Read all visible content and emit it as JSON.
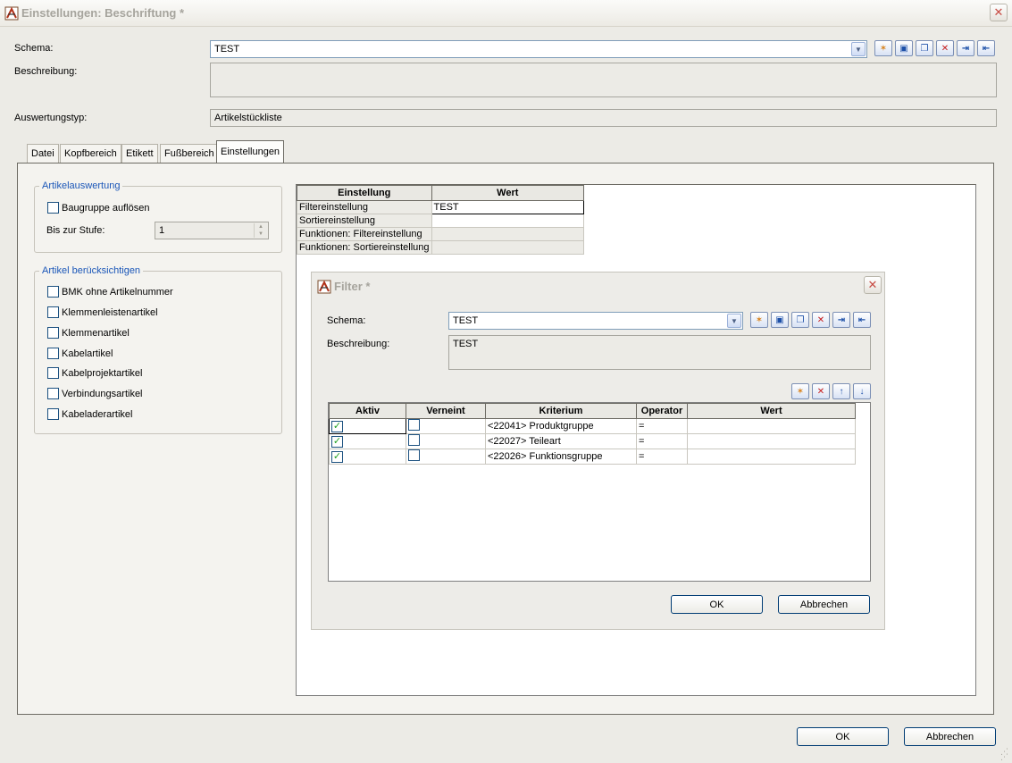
{
  "window": {
    "title": "Einstellungen: Beschriftung *",
    "close_glyph": "✕"
  },
  "schema": {
    "label": "Schema:",
    "value": "TEST",
    "description_label": "Beschreibung:",
    "description_value": "",
    "evaluation_label": "Auswertungstyp:",
    "evaluation_value": "Artikelstückliste",
    "toolbar_icons": [
      "new-icon",
      "save-icon",
      "copy-icon",
      "delete-icon",
      "import-icon",
      "export-icon"
    ]
  },
  "tabs": [
    {
      "label": "Datei",
      "active": false
    },
    {
      "label": "Kopfbereich",
      "active": false
    },
    {
      "label": "Etikett",
      "active": false
    },
    {
      "label": "Fußbereich",
      "active": false
    },
    {
      "label": "Einstellungen",
      "active": true
    }
  ],
  "article_eval": {
    "title": "Artikelauswertung",
    "dissolve_label": "Baugruppe auflösen",
    "dissolve_checked": false,
    "level_label": "Bis zur Stufe:",
    "level_value": "1"
  },
  "consider": {
    "title": "Artikel berücksichtigen",
    "items": [
      {
        "label": "BMK ohne Artikelnummer",
        "checked": false
      },
      {
        "label": "Klemmenleistenartikel",
        "checked": false
      },
      {
        "label": "Klemmenartikel",
        "checked": false
      },
      {
        "label": "Kabelartikel",
        "checked": false
      },
      {
        "label": "Kabelprojektartikel",
        "checked": false
      },
      {
        "label": "Verbindungsartikel",
        "checked": false
      },
      {
        "label": "Kabeladerartikel",
        "checked": false
      }
    ]
  },
  "settings_table": {
    "headers": [
      "Einstellung",
      "Wert"
    ],
    "rows": [
      {
        "name": "Filtereinstellung",
        "value": "TEST"
      },
      {
        "name": "Sortiereinstellung",
        "value": ""
      },
      {
        "name": "Funktionen: Filtereinstellung",
        "value": ""
      },
      {
        "name": "Funktionen: Sortiereinstellung",
        "value": ""
      }
    ]
  },
  "filter_dialog": {
    "title": "Filter *",
    "schema_label": "Schema:",
    "schema_value": "TEST",
    "description_label": "Beschreibung:",
    "description_value": "TEST",
    "headers": [
      "Aktiv",
      "Verneint",
      "Kriterium",
      "Operator",
      "Wert"
    ],
    "rows": [
      {
        "active": true,
        "negated": false,
        "criterion": "<22041> Produktgruppe",
        "operator": "=",
        "value": ""
      },
      {
        "active": true,
        "negated": false,
        "criterion": "<22027> Teileart",
        "operator": "=",
        "value": ""
      },
      {
        "active": true,
        "negated": false,
        "criterion": "<22026> Funktionsgruppe",
        "operator": "=",
        "value": ""
      }
    ],
    "ok_label": "OK",
    "cancel_label": "Abbrechen"
  },
  "footer": {
    "ok_label": "OK",
    "cancel_label": "Abbrechen"
  }
}
